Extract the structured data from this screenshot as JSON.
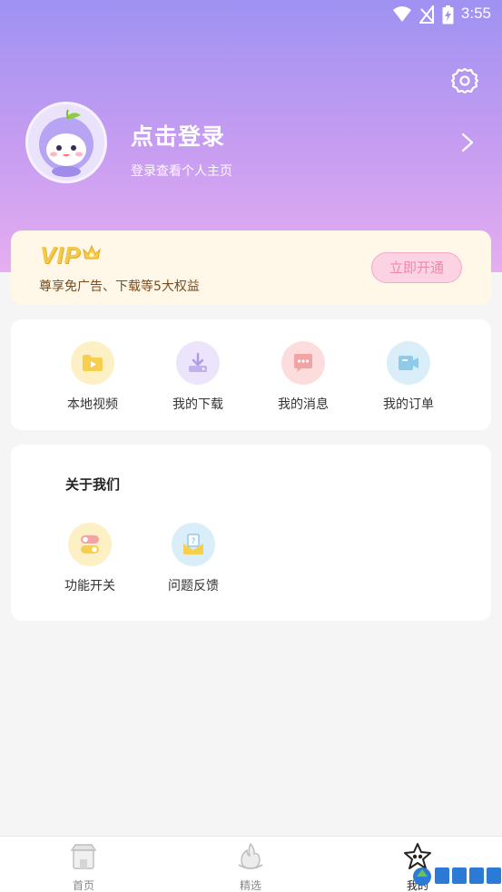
{
  "status_bar": {
    "time": "3:55"
  },
  "profile": {
    "title": "点击登录",
    "subtitle": "登录查看个人主页"
  },
  "vip": {
    "logo": "VIP",
    "description": "尊享免广告、下载等5大权益",
    "button_label": "立即开通"
  },
  "quick_actions": [
    {
      "label": "本地视频",
      "icon": "play-folder-icon"
    },
    {
      "label": "我的下载",
      "icon": "download-icon"
    },
    {
      "label": "我的消息",
      "icon": "message-icon"
    },
    {
      "label": "我的订单",
      "icon": "order-icon"
    }
  ],
  "about": {
    "title": "关于我们",
    "items": [
      {
        "label": "功能开关",
        "icon": "toggle-icon"
      },
      {
        "label": "问题反馈",
        "icon": "feedback-icon"
      }
    ]
  },
  "tabbar": {
    "tabs": [
      {
        "label": "首页",
        "icon": "home-icon"
      },
      {
        "label": "精选",
        "icon": "featured-icon"
      },
      {
        "label": "我的",
        "icon": "profile-star-icon"
      }
    ]
  },
  "colors": {
    "header_top": "#9f92f2",
    "header_bottom": "#e5aef0",
    "vip_gold": "#f2c94c",
    "vip_button": "#fbd3e2"
  }
}
